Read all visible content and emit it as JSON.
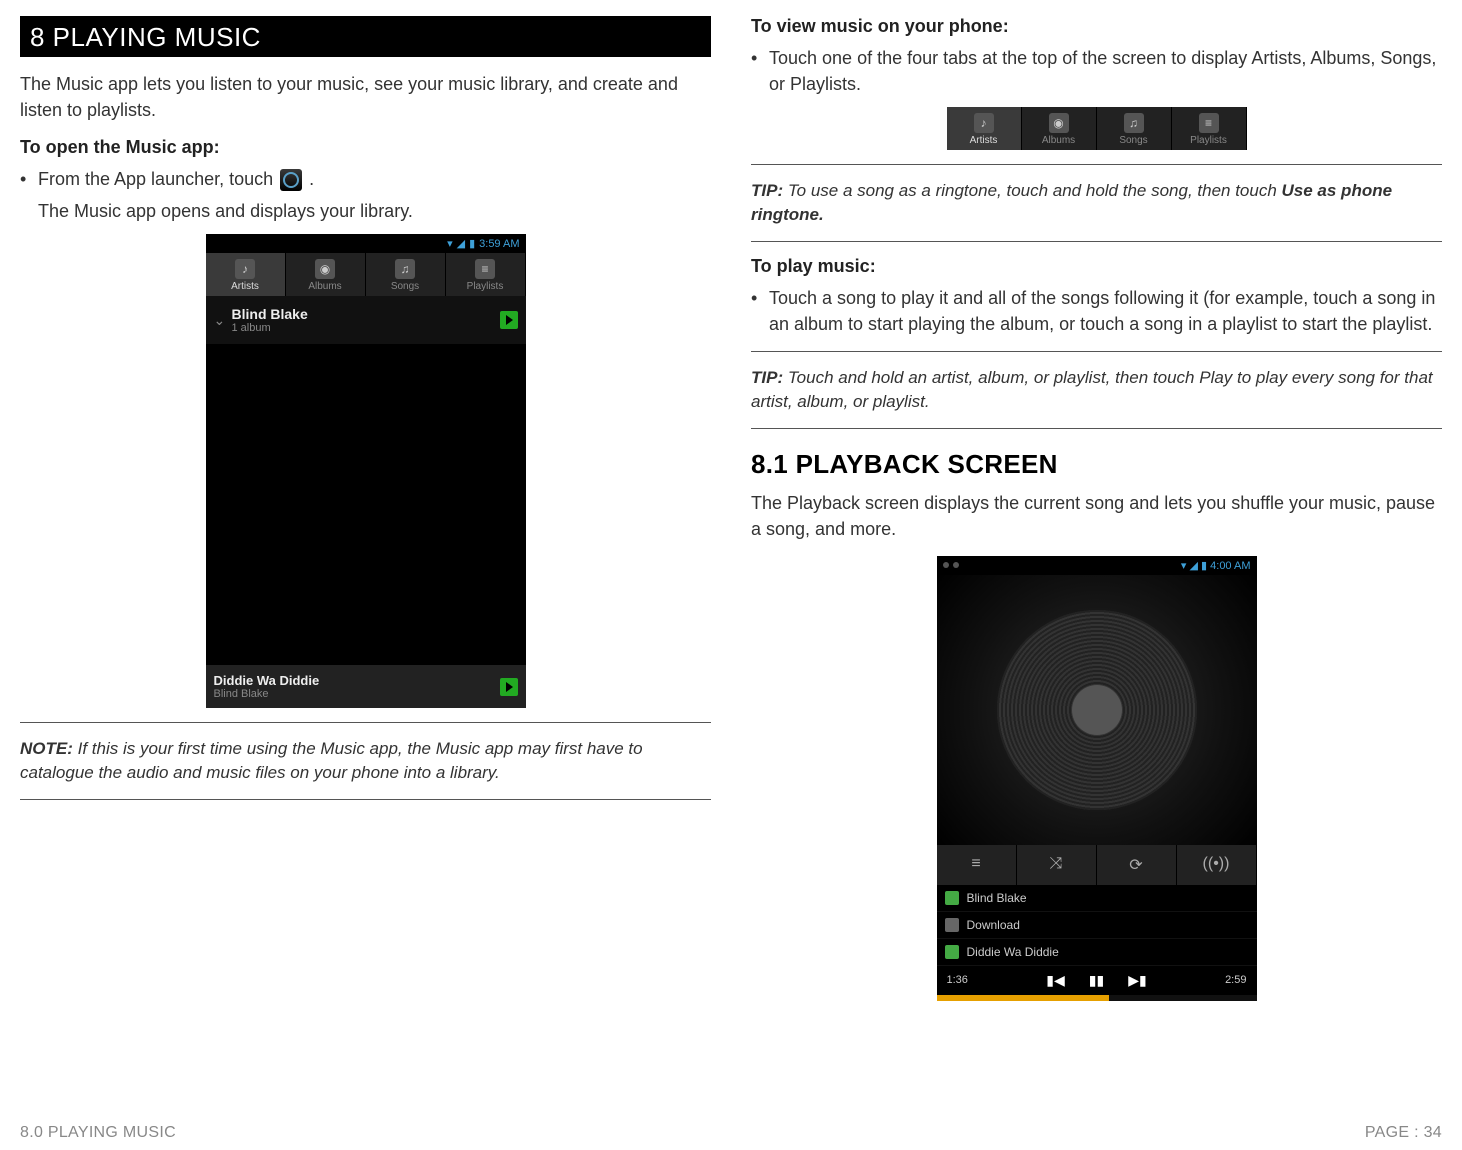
{
  "left": {
    "section_title": "8 PLAYING MUSIC",
    "intro": "The Music app lets you listen to your music, see your music library, and create and listen to playlists.",
    "open_heading": "To open the Music app:",
    "open_bullet_pre": "From the App launcher, touch ",
    "open_bullet_post": " .",
    "open_result": "The Music app opens and displays your library.",
    "note_label": "NOTE:",
    "note_body": " If this is your first time using the Music app, the Music app may first have to catalogue the audio and music files on your phone into a library."
  },
  "phone1": {
    "time": "3:59 AM",
    "tabs": {
      "artists": "Artists",
      "albums": "Albums",
      "songs": "Songs",
      "playlists": "Playlists"
    },
    "artist_name": "Blind Blake",
    "artist_sub": "1 album",
    "np_title": "Diddie Wa Diddie",
    "np_artist": "Blind Blake"
  },
  "right": {
    "view_heading": "To view music on your phone:",
    "view_bullet": "Touch one of the four tabs at the top of the screen to display Artists, Albums, Songs, or Playlists.",
    "tip1_label": "TIP:",
    "tip1_body": " To use a song as a ringtone, touch and hold the song, then touch ",
    "tip1_bold": "Use as phone ringtone.",
    "play_heading": "To play music:",
    "play_bullet": "Touch a song to play it and all of the songs following it (for example, touch a song in an album to start playing the album, or touch a song in a playlist to start the playlist.",
    "tip2_label": "TIP:",
    "tip2_body": " Touch and hold an artist, album, or playlist, then touch Play to play every song for that artist, album, or playlist.",
    "subsection": "8.1 PLAYBACK SCREEN",
    "subsection_intro": "The Playback screen displays the current song and lets you shuffle your music, pause a song, and more."
  },
  "tabs_strip": {
    "artists": "Artists",
    "albums": "Albums",
    "songs": "Songs",
    "playlists": "Playlists"
  },
  "phone2": {
    "time": "4:00 AM",
    "artist": "Blind Blake",
    "album": "Download",
    "track": "Diddie Wa Diddie",
    "elapsed": "1:36",
    "total": "2:59"
  },
  "footer": {
    "left": "8.0 PLAYING MUSIC",
    "right": "PAGE : 34"
  }
}
